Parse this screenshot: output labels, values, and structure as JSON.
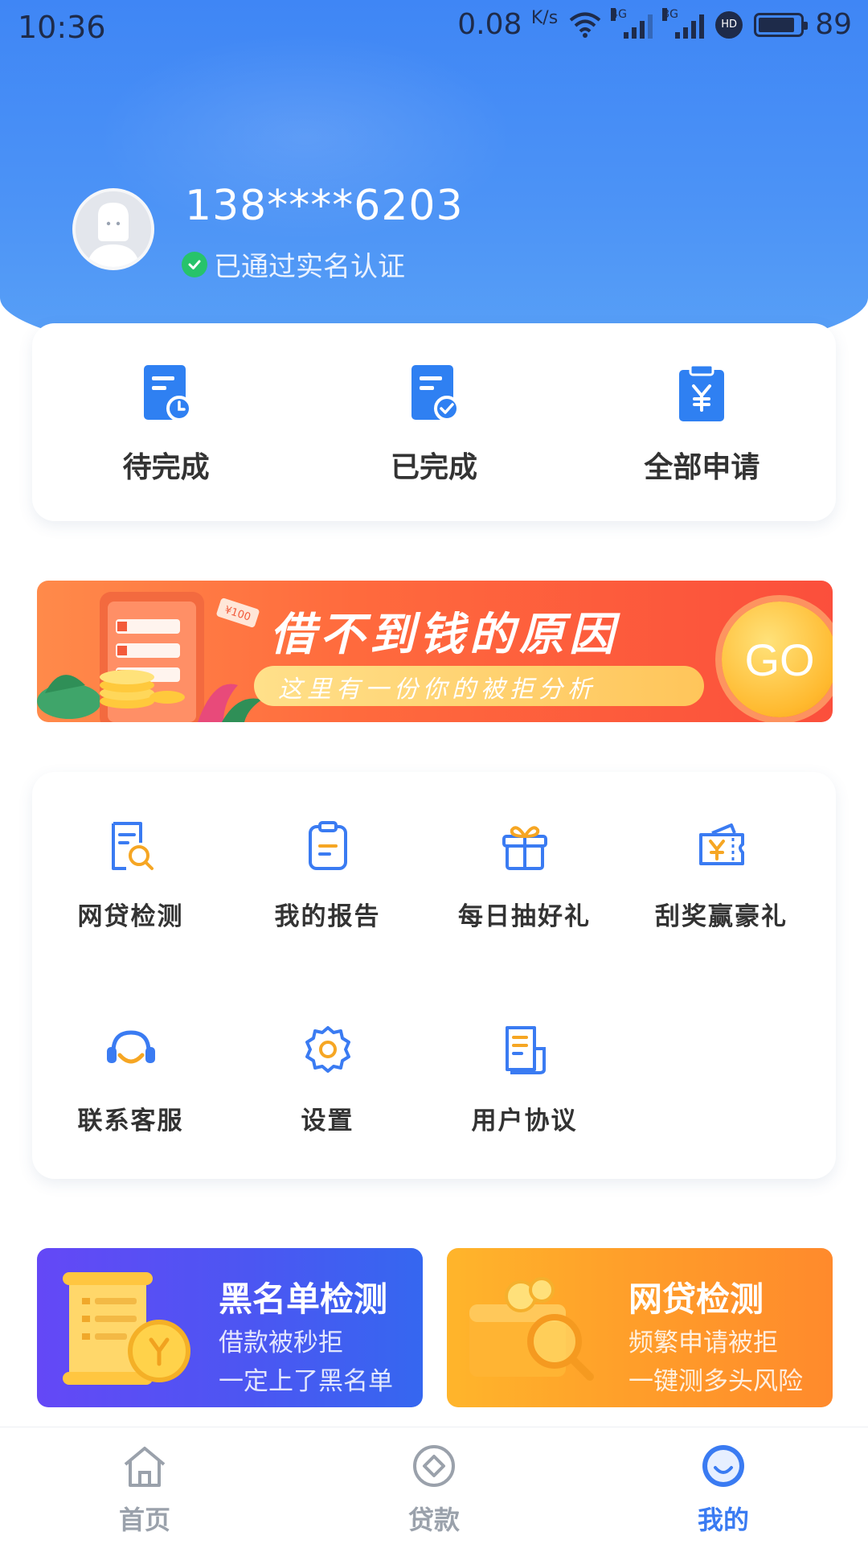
{
  "status_bar": {
    "time": "10:36",
    "net_speed": "0.08",
    "net_unit": "K/s",
    "sim1_label": "4G",
    "sim2_label": "3G",
    "hd_label": "HD",
    "battery": "89"
  },
  "profile": {
    "phone": "138****6203",
    "verified_text": "已通过实名认证"
  },
  "orders": [
    {
      "label": "待完成",
      "icon": "pending-doc-icon"
    },
    {
      "label": "已完成",
      "icon": "completed-doc-icon"
    },
    {
      "label": "全部申请",
      "icon": "clipboard-yen-icon"
    }
  ],
  "banner": {
    "title": "借不到钱的原因",
    "subtitle": "这里有一份你的被拒分析",
    "go_label": "GO",
    "tag": "¥100"
  },
  "menu": [
    {
      "label": "网贷检测",
      "icon": "doc-search-icon"
    },
    {
      "label": "我的报告",
      "icon": "report-icon"
    },
    {
      "label": "每日抽好礼",
      "icon": "gift-icon"
    },
    {
      "label": "刮奖赢豪礼",
      "icon": "ticket-icon"
    },
    {
      "label": "联系客服",
      "icon": "headset-icon"
    },
    {
      "label": "设置",
      "icon": "gear-icon"
    },
    {
      "label": "用户协议",
      "icon": "agreement-icon"
    }
  ],
  "promos": [
    {
      "title": "黑名单检测",
      "line1": "借款被秒拒",
      "line2": "一定上了黑名单"
    },
    {
      "title": "网贷检测",
      "line1": "频繁申请被拒",
      "line2": "一键测多头风险"
    }
  ],
  "tabs": [
    {
      "label": "首页",
      "icon": "home-icon",
      "active": false
    },
    {
      "label": "贷款",
      "icon": "loan-icon",
      "active": false
    },
    {
      "label": "我的",
      "icon": "profile-face-icon",
      "active": true
    }
  ],
  "colors": {
    "primary": "#3a7bf2",
    "header_bg": "#4c93f6",
    "verified_green": "#27c36b",
    "banner_red": "#fb4f3c",
    "promo_purple": "#4c56f2",
    "promo_orange": "#ff9b2a"
  }
}
